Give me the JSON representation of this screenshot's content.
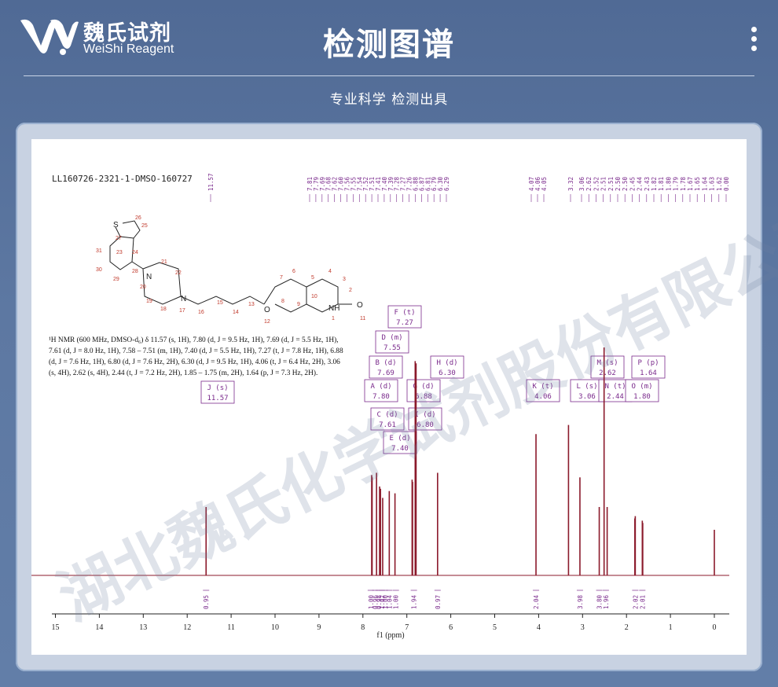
{
  "brand": {
    "name_cn": "魏氏试剂",
    "name_en": "WeiShi Reagent",
    "logo_icon": "ws-logo-icon"
  },
  "header": {
    "title": "检测图谱",
    "subtitle": "专业科学  检测出具"
  },
  "watermark": "湖北魏氏化学试剂股份有限公司",
  "spectrum": {
    "sample_id": "LL160726-2321-1-DMSO-160727",
    "peak_lists": {
      "j": [
        "11.57"
      ],
      "aromatic": [
        "7.81",
        "7.79",
        "7.69",
        "7.68",
        "7.62",
        "7.60",
        "7.56",
        "7.55",
        "7.54",
        "7.52",
        "7.51",
        "7.41",
        "7.40",
        "7.39",
        "7.28",
        "7.27",
        "7.26",
        "6.88",
        "6.87",
        "6.81",
        "6.79",
        "6.30",
        "6.29"
      ],
      "k": [
        "4.07",
        "4.06",
        "4.05"
      ],
      "water": [
        "3.32"
      ],
      "aliphatic": [
        "3.06",
        "2.62",
        "2.52",
        "2.51",
        "2.51",
        "2.50",
        "2.50",
        "2.45",
        "2.44",
        "2.43",
        "1.82",
        "1.81",
        "1.80",
        "1.79",
        "1.78",
        "1.67",
        "1.65",
        "1.64",
        "1.63",
        "1.62",
        "0.00"
      ]
    },
    "nmr_text": [
      "¹H NMR (600 MHz, DMSO-d₆) δ 11.57 (s, 1H), 7.80 (d, J = 9.5 Hz, 1H), 7.69 (d, J = 5.5 Hz, 1H),",
      "7.61 (d, J = 8.0 Hz, 1H), 7.58 – 7.51 (m, 1H), 7.40 (d, J = 5.5 Hz, 1H), 7.27 (t, J = 7.8 Hz, 1H), 6.88",
      "(d, J = 7.6 Hz, 1H), 6.80 (d, J = 7.6 Hz, 2H), 6.30 (d, J = 9.5 Hz, 1H), 4.06 (t, J = 6.4 Hz, 2H), 3.06",
      "(s, 4H), 2.62 (s, 4H), 2.44 (t, J = 7.2 Hz, 2H), 1.85 – 1.75 (m, 2H), 1.64 (p, J = 7.3 Hz, 2H)."
    ],
    "assignments": [
      {
        "label": "J (s)",
        "value": "11.57"
      },
      {
        "label": "F (t)",
        "value": "7.27"
      },
      {
        "label": "D (m)",
        "value": "7.55"
      },
      {
        "label": "B (d)",
        "value": "7.69"
      },
      {
        "label": "A (d)",
        "value": "7.80"
      },
      {
        "label": "C (d)",
        "value": "7.61"
      },
      {
        "label": "E (d)",
        "value": "7.40"
      },
      {
        "label": "G (d)",
        "value": "6.88"
      },
      {
        "label": "I (d)",
        "value": "6.80"
      },
      {
        "label": "H (d)",
        "value": "6.30"
      },
      {
        "label": "K (t)",
        "value": "4.06"
      },
      {
        "label": "L (s)",
        "value": "3.06"
      },
      {
        "label": "M (s)",
        "value": "2.62"
      },
      {
        "label": "N (t)",
        "value": "2.44"
      },
      {
        "label": "O (m)",
        "value": "1.80"
      },
      {
        "label": "P (p)",
        "value": "1.64"
      }
    ],
    "integrals": [
      "0.95",
      "1.00",
      "0.96",
      "0.98",
      "1.02",
      "1.00",
      "1.04",
      "1.00",
      "1.94",
      "0.97",
      "2.04",
      "3.98",
      "3.80",
      "1.96",
      "2.02",
      "2.01"
    ],
    "structure_atoms": [
      "S",
      "26",
      "27",
      "25",
      "23",
      "24",
      "31",
      "30",
      "29",
      "28",
      "N",
      "20",
      "21",
      "22",
      "19",
      "18",
      "N",
      "17",
      "16",
      "15",
      "14",
      "13",
      "O",
      "12",
      "7",
      "8",
      "6",
      "5",
      "9",
      "10",
      "4",
      "3",
      "2",
      "NH",
      "1",
      "O",
      "11"
    ],
    "axis": {
      "ticks": [
        "15",
        "14",
        "13",
        "12",
        "11",
        "10",
        "9",
        "8",
        "7",
        "6",
        "5",
        "4",
        "3",
        "2",
        "1",
        "0"
      ],
      "label": "f1 (ppm)"
    }
  },
  "colors": {
    "spectrum": "#8b1a2b",
    "annotation": "#7a2a8c",
    "background": "#5a749e"
  }
}
